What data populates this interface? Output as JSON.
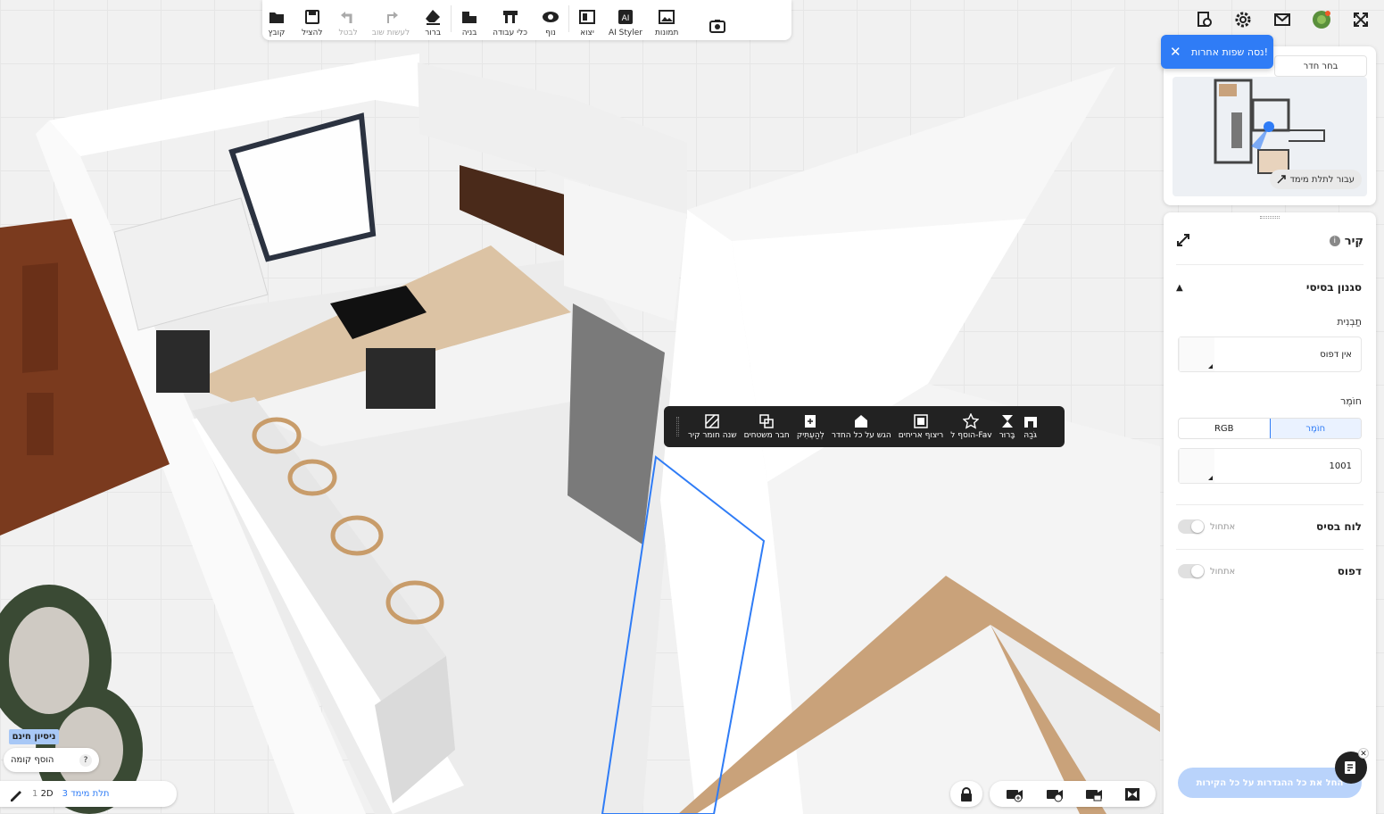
{
  "top_toolbar": {
    "file": "קובץ",
    "save": "להציל",
    "undo": "לבטל",
    "redo": "לעשות שוב",
    "clear": "ברור",
    "build": "בניה",
    "tools": "כלי עבודה",
    "view": "נוף",
    "export": "יצוא",
    "ai_styler": "AI Styler",
    "images": "תמונות"
  },
  "header_icons": [
    "search-plan-icon",
    "settings-icon",
    "mail-icon",
    "avatar",
    "fullscreen-icon"
  ],
  "language_tip": {
    "text": "נסה שפות אחרות!"
  },
  "minimap": {
    "choose_room": "בחר חדר",
    "go_3d": "עבור לתלת מימד"
  },
  "panel": {
    "title": "קִיר",
    "section": "סגנון בסיסי",
    "template_label": "תַבְנִית",
    "template_value": "אין דפוס",
    "material_label": "חוֹמֶר",
    "seg_rgb": "RGB",
    "seg_material": "חוֹמֶר",
    "material_value": "1001",
    "baseboard_label": "לוח בסיס",
    "baseboard_state": "אתחול",
    "pattern_label": "דפוס",
    "pattern_state": "אתחול",
    "apply_all": "החל את כל ההגדרות על כל הקירות"
  },
  "context_toolbar": {
    "height": "גֹּבַהּ",
    "clear": "בָּרוּר",
    "add_fav": "הוסף ל-Fav",
    "tile_arrays": "ריצוף אריחים",
    "apply_room": "הגש על כל החדר",
    "copy": "לְהַעְתִּיק",
    "join_surfaces": "חבר משטחים",
    "change_material": "שנה חומר קיר"
  },
  "bottom_left": {
    "free_trial": "ניסיון חינם",
    "add_floor": "הוסף קומה",
    "help": "?",
    "view_2d_num": "1",
    "view_2d": "2D",
    "view_3d_num": "3",
    "view_3d": "תלת מימד"
  },
  "colors": {
    "accent": "#2f7cf6",
    "dark_bar": "#222222",
    "panel_bg": "#ffffff"
  }
}
